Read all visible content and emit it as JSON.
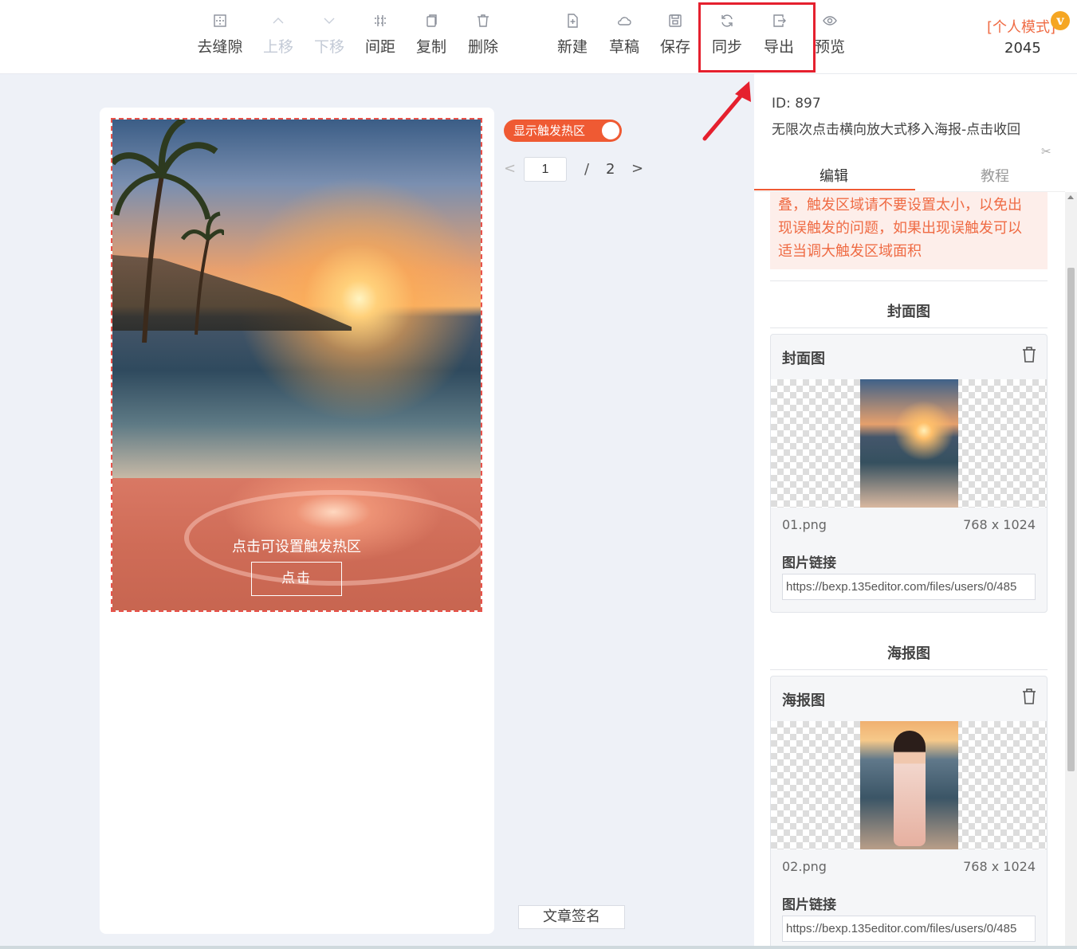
{
  "toolbar": {
    "tools": [
      {
        "label": "去缝隙",
        "icon": "gap-remove-icon",
        "disabled": false
      },
      {
        "label": "上移",
        "icon": "chevron-up-icon",
        "disabled": true
      },
      {
        "label": "下移",
        "icon": "chevron-down-icon",
        "disabled": true
      },
      {
        "label": "间距",
        "icon": "spacing-icon",
        "disabled": false
      },
      {
        "label": "复制",
        "icon": "copy-icon",
        "disabled": false
      },
      {
        "label": "删除",
        "icon": "trash-icon",
        "disabled": false
      },
      {
        "label": "新建",
        "icon": "new-file-icon",
        "disabled": false
      },
      {
        "label": "草稿",
        "icon": "cloud-icon",
        "disabled": false
      },
      {
        "label": "保存",
        "icon": "save-icon",
        "disabled": false
      },
      {
        "label": "同步",
        "icon": "sync-icon",
        "disabled": false
      },
      {
        "label": "导出",
        "icon": "export-icon",
        "disabled": false
      },
      {
        "label": "预览",
        "icon": "eye-icon",
        "disabled": false
      }
    ],
    "mode_label": "[个人模式]",
    "vip_badge": "v",
    "count": "2045"
  },
  "canvas": {
    "hotzone_text": "点击可设置触发热区",
    "hotzone_button": "点击"
  },
  "controls": {
    "toggle_label": "显示触发热区",
    "toggle_on": true,
    "pager_prev": "<",
    "page_current": "1",
    "page_sep": "/",
    "page_total": "2",
    "pager_next": ">",
    "sign_button": "文章签名"
  },
  "panel": {
    "id_text": "ID: 897",
    "description": "无限次点击横向放大式移入海报-点击收回",
    "tabs": [
      {
        "label": "编辑",
        "active": true
      },
      {
        "label": "教程",
        "active": false
      }
    ],
    "warning_lines": [
      "叠，触发区域请不要设置太小，以免出",
      "现误触发的问题，如果出现误触发可以",
      "适当调大触发区域面积"
    ],
    "sections": [
      {
        "section_title": "封面图",
        "card_title": "封面图",
        "file_name": "01.png",
        "file_size": "768 x 1024",
        "link_label": "图片链接",
        "link_value": "https://bexp.135editor.com/files/users/0/485"
      },
      {
        "section_title": "海报图",
        "card_title": "海报图",
        "file_name": "02.png",
        "file_size": "768 x 1024",
        "link_label": "图片链接",
        "link_value": "https://bexp.135editor.com/files/users/0/485"
      }
    ]
  },
  "colors": {
    "accent": "#ef5a33",
    "highlight": "#e5202e",
    "warning_text": "#ef6b44",
    "warning_bg": "#fdeeea"
  }
}
